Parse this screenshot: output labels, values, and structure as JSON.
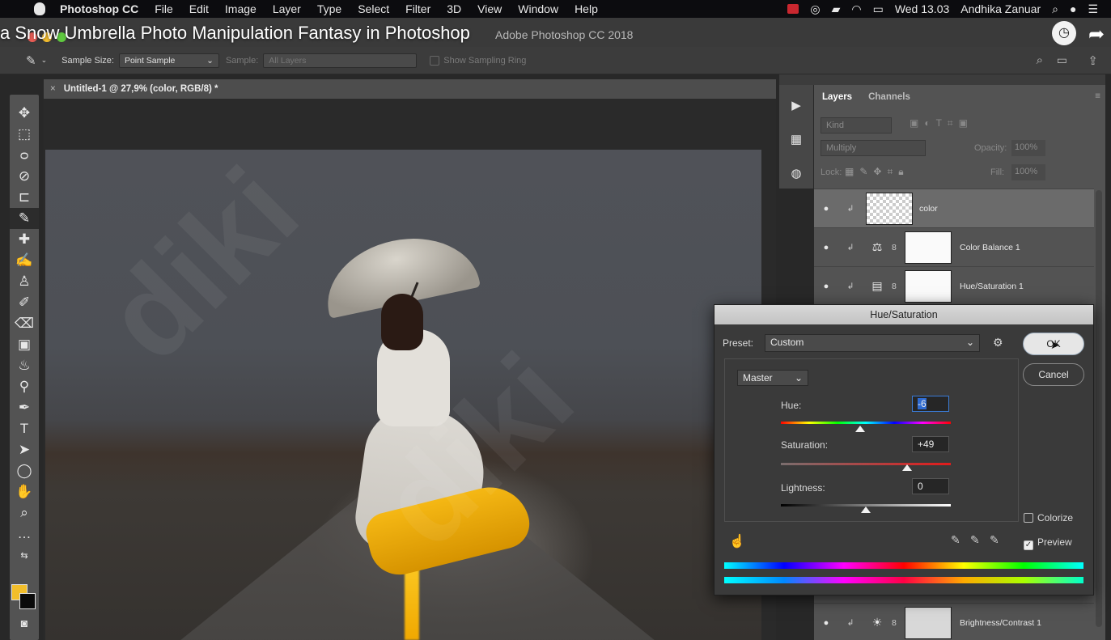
{
  "menubar": {
    "app": "Photoshop CC",
    "items": [
      "File",
      "Edit",
      "Image",
      "Layer",
      "Type",
      "Select",
      "Filter",
      "3D",
      "View",
      "Window",
      "Help"
    ],
    "clock": "Wed 13.03",
    "user": "Andhika Zanuar"
  },
  "video_title": "a Snow Umbrella Photo Manipulation Fantasy in Photoshop",
  "window_title": "Adobe Photoshop CC 2018",
  "options": {
    "sample_size_label": "Sample Size:",
    "sample_size_value": "Point Sample",
    "sample_label": "Sample:",
    "sample_value": "All Layers",
    "show_ring": "Show Sampling Ring"
  },
  "document": {
    "tab": "Untitled-1 @ 27,9% (color, RGB/8) *"
  },
  "colors": {
    "foreground": "#f2be2b",
    "background": "#0a0a0a"
  },
  "layers_panel": {
    "tabs": [
      "Layers",
      "Channels"
    ],
    "kind": "Kind",
    "blend_mode": "Multiply",
    "opacity_label": "Opacity:",
    "opacity": "100%",
    "lock_label": "Lock:",
    "fill_label": "Fill:",
    "fill": "100%",
    "layers": [
      {
        "name": "color"
      },
      {
        "name": "Color Balance 1"
      },
      {
        "name": "Hue/Saturation 1"
      },
      {
        "name": "Brightness/Contrast 1"
      }
    ]
  },
  "dialog": {
    "title": "Hue/Saturation",
    "preset_label": "Preset:",
    "preset": "Custom",
    "ok": "OK",
    "cancel": "Cancel",
    "channel": "Master",
    "hue_label": "Hue:",
    "hue": "-6",
    "saturation_label": "Saturation:",
    "saturation": "+49",
    "lightness_label": "Lightness:",
    "lightness": "0",
    "colorize": "Colorize",
    "preview": "Preview"
  }
}
